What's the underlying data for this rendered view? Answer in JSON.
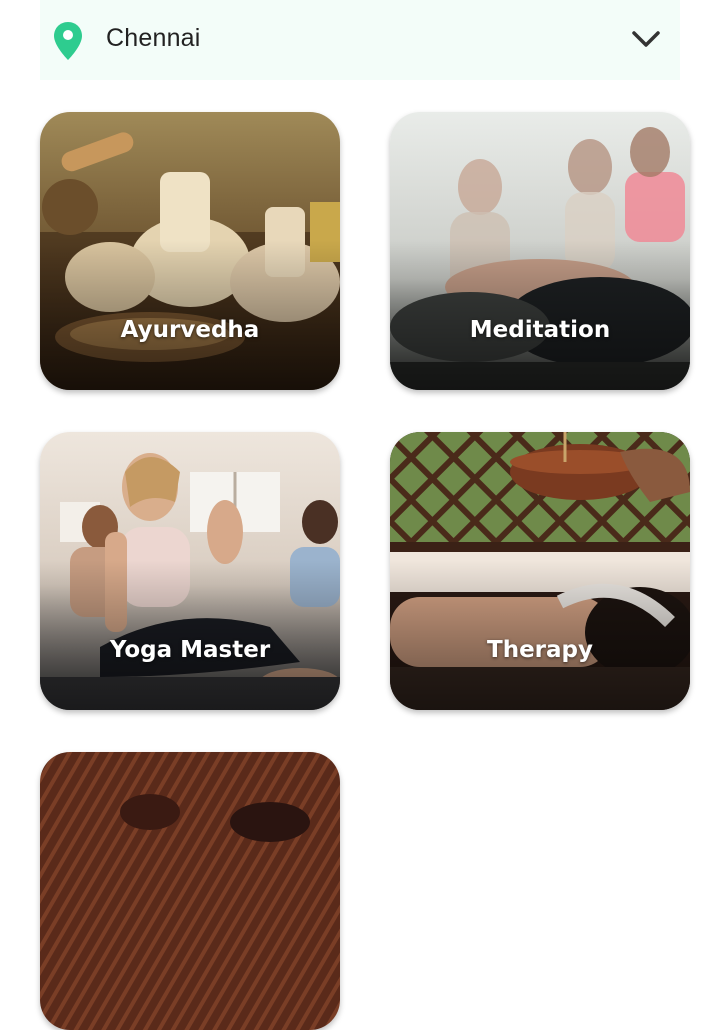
{
  "location": {
    "city": "Chennai",
    "pin_icon": "map-pin-icon",
    "dropdown_icon": "chevron-down-icon",
    "accent_color": "#2ecc8f",
    "background_color": "#f3fdf9"
  },
  "categories": [
    {
      "label": "Ayurvedha"
    },
    {
      "label": "Meditation"
    },
    {
      "label": "Yoga Master"
    },
    {
      "label": "Therapy"
    },
    {
      "label": ""
    }
  ]
}
